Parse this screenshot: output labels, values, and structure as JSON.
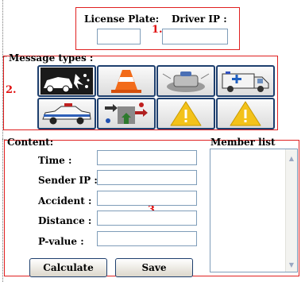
{
  "top": {
    "license_plate_label": "License Plate:",
    "driver_ip_label": "Driver IP :",
    "license_plate_value": "",
    "driver_ip_value": "",
    "marker": "1."
  },
  "message_types": {
    "title": "Message types :",
    "marker": "2.",
    "buttons": [
      {
        "icon": "car-crash-icon"
      },
      {
        "icon": "traffic-cone-icon"
      },
      {
        "icon": "police-siren-icon"
      },
      {
        "icon": "ambulance-icon"
      },
      {
        "icon": "police-car-icon"
      },
      {
        "icon": "detour-arrows-icon"
      },
      {
        "icon": "warning-sign-icon"
      },
      {
        "icon": "warning-sign-icon"
      }
    ]
  },
  "content": {
    "title": "Content:",
    "marker": "3.",
    "fields": [
      {
        "label": "Time :",
        "value": ""
      },
      {
        "label": "Sender IP :",
        "value": ""
      },
      {
        "label": "Accident :",
        "value": ""
      },
      {
        "label": "Distance :",
        "value": ""
      },
      {
        "label": "P-value :",
        "value": ""
      }
    ],
    "calculate_label": "Calculate",
    "save_label": "Save"
  },
  "member_list": {
    "title": "Member list",
    "items": []
  },
  "colors": {
    "annotation_red": "#e01010",
    "button_border": "#1e3f6e",
    "input_border": "#7f9db9"
  }
}
